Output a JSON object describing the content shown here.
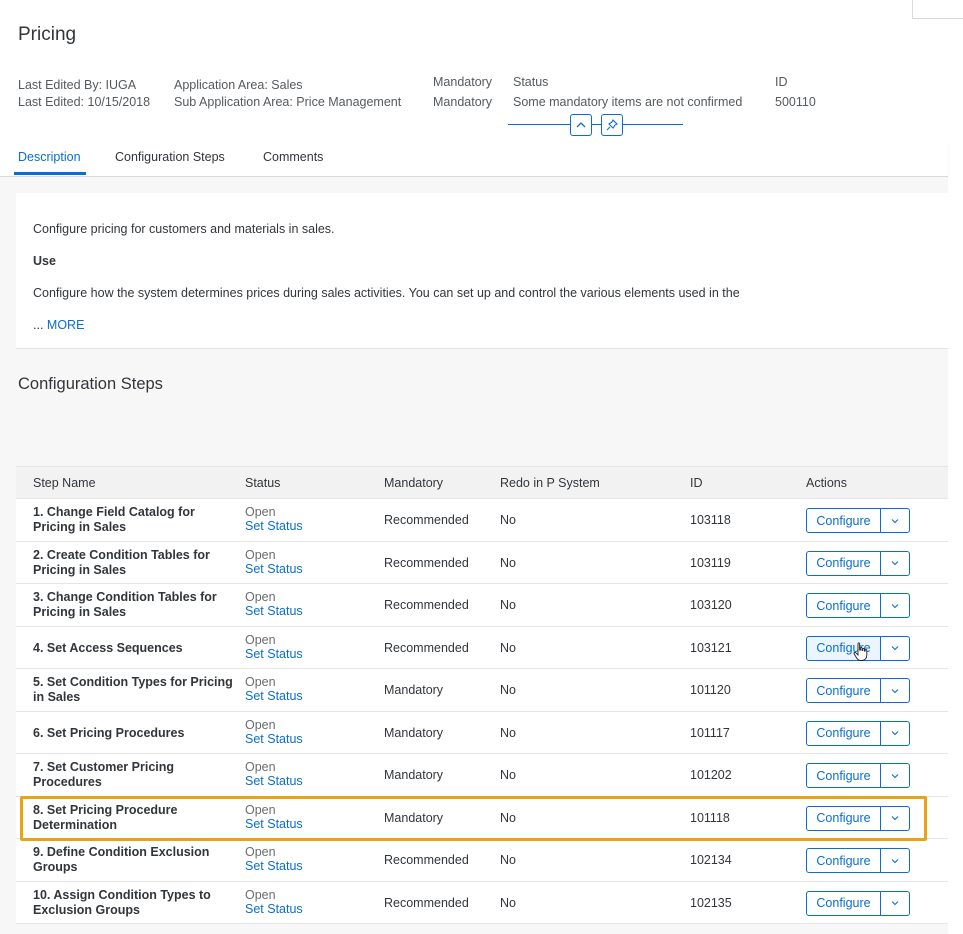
{
  "page": {
    "title": "Pricing"
  },
  "header": {
    "last_edited_by": "Last Edited By: IUGA",
    "last_edited": "Last Edited: 10/15/2018",
    "application_area": "Application Area: Sales",
    "sub_application_area": "Sub Application Area: Price Management",
    "mandatory_label": "Mandatory",
    "mandatory_value": "Mandatory",
    "status_label": "Status",
    "status_value": "Some mandatory items are not confirmed",
    "id_label": "ID",
    "id_value": "500110",
    "collapse_icon": "chevron-up-icon",
    "pin_icon": "pin-icon"
  },
  "tabs": [
    {
      "label": "Description",
      "selected": true
    },
    {
      "label": "Configuration Steps",
      "selected": false
    },
    {
      "label": "Comments",
      "selected": false
    }
  ],
  "description": {
    "summary": "Configure pricing for customers and materials in sales.",
    "use_heading": "Use",
    "use_text": "Configure how the system determines prices during sales activities. You can set up and control the various elements used in the",
    "more_prefix": "...",
    "more_label": "MORE"
  },
  "config_steps": {
    "title": "Configuration Steps",
    "columns": [
      "Step Name",
      "Status",
      "Mandatory",
      "Redo in P System",
      "ID",
      "Actions"
    ],
    "rows": [
      {
        "name": "1. Change Field Catalog for Pricing in Sales",
        "status": "Open",
        "status_link": "Set Status",
        "mandatory": "Recommended",
        "redo": "No",
        "id": "103118",
        "action": "Configure"
      },
      {
        "name": "2. Create Condition Tables for Pricing in Sales",
        "status": "Open",
        "status_link": "Set Status",
        "mandatory": "Recommended",
        "redo": "No",
        "id": "103119",
        "action": "Configure"
      },
      {
        "name": "3. Change Condition Tables for Pricing in Sales",
        "status": "Open",
        "status_link": "Set Status",
        "mandatory": "Recommended",
        "redo": "No",
        "id": "103120",
        "action": "Configure"
      },
      {
        "name": "4. Set Access Sequences",
        "status": "Open",
        "status_link": "Set Status",
        "mandatory": "Recommended",
        "redo": "No",
        "id": "103121",
        "action": "Configure"
      },
      {
        "name": "5. Set Condition Types for Pricing in Sales",
        "status": "Open",
        "status_link": "Set Status",
        "mandatory": "Mandatory",
        "redo": "No",
        "id": "101120",
        "action": "Configure"
      },
      {
        "name": "6. Set Pricing Procedures",
        "status": "Open",
        "status_link": "Set Status",
        "mandatory": "Mandatory",
        "redo": "No",
        "id": "101117",
        "action": "Configure"
      },
      {
        "name": "7. Set Customer Pricing Procedures",
        "status": "Open",
        "status_link": "Set Status",
        "mandatory": "Mandatory",
        "redo": "No",
        "id": "101202",
        "action": "Configure"
      },
      {
        "name": "8. Set Pricing Procedure Determination",
        "status": "Open",
        "status_link": "Set Status",
        "mandatory": "Mandatory",
        "redo": "No",
        "id": "101118",
        "action": "Configure"
      },
      {
        "name": "9. Define Condition Exclusion Groups",
        "status": "Open",
        "status_link": "Set Status",
        "mandatory": "Recommended",
        "redo": "No",
        "id": "102134",
        "action": "Configure"
      },
      {
        "name": "10. Assign Condition Types to Exclusion Groups",
        "status": "Open",
        "status_link": "Set Status",
        "mandatory": "Recommended",
        "redo": "No",
        "id": "102135",
        "action": "Configure"
      }
    ],
    "highlighted_row": 8,
    "dropdown_icon": "chevron-down-icon"
  },
  "colors": {
    "accent": "#0a6ed1",
    "highlight": "#e8a317",
    "text": "#32363a"
  }
}
